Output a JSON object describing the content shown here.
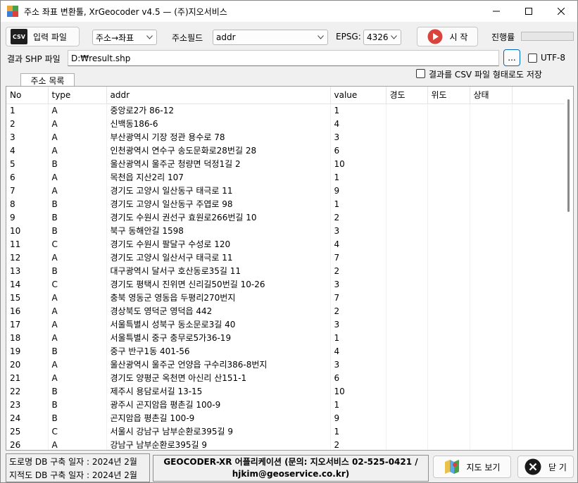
{
  "window": {
    "title": "주소 좌표 변환툴, XrGeocoder v4.5 — (주)지오서비스"
  },
  "toolbar": {
    "input_file_label": "입력 파일",
    "csv_icon_text": "CSV",
    "mode_value": "주소→좌표",
    "address_field_label": "주소필드",
    "address_field_value": "addr",
    "epsg_label": "EPSG:",
    "epsg_value": "4326",
    "start_label": "시 작",
    "progress_label": "진행률",
    "progress_fraction": 0
  },
  "output": {
    "label": "결과 SHP 파일",
    "path": "D:₩result.shp",
    "browse_label": "...",
    "utf8_label": "UTF-8",
    "utf8_checked": false,
    "csv_option_label": "결과를 CSV 파일 형태로도 저장",
    "csv_option_checked": false
  },
  "tab": {
    "label": "주소 목록"
  },
  "table": {
    "headers": [
      "No",
      "type",
      "addr",
      "value",
      "경도",
      "위도",
      "상태"
    ],
    "rows": [
      [
        "1",
        "A",
        "중앙로2가 86-12",
        "1"
      ],
      [
        "2",
        "A",
        "신백동186-6",
        "4"
      ],
      [
        "3",
        "A",
        "부산광역시 기장 정관 용수로 78",
        "3"
      ],
      [
        "4",
        "A",
        "인천광역시 연수구 송도문화로28번길 28",
        "6"
      ],
      [
        "5",
        "B",
        "울산광역시 울주군 청량면 덕정1길 2",
        "10"
      ],
      [
        "6",
        "A",
        "목천읍 지산2리 107",
        "1"
      ],
      [
        "7",
        "A",
        "경기도 고양시 일산동구 태극로 11",
        "9"
      ],
      [
        "8",
        "B",
        "경기도 고양시 일산동구 주엽로 98",
        "1"
      ],
      [
        "9",
        "B",
        "경기도 수원시 권선구 효원로266번길 10",
        "2"
      ],
      [
        "10",
        "B",
        "북구 동해안길 1598",
        "3"
      ],
      [
        "11",
        "C",
        "경기도 수원시 팔달구 수성로 120",
        "4"
      ],
      [
        "12",
        "A",
        "경기도 고양시 일산서구 태극로 11",
        "7"
      ],
      [
        "13",
        "B",
        "대구광역시 달서구 호산동로35길 11",
        "2"
      ],
      [
        "14",
        "C",
        "경기도 평택시 진위면 신리길50번길 10-26",
        "3"
      ],
      [
        "15",
        "A",
        "충북 영동군 영동읍 두평리270번지",
        "7"
      ],
      [
        "16",
        "A",
        "경상북도 영덕군 영덕읍 442",
        "2"
      ],
      [
        "17",
        "A",
        "서울특별시 성북구 동소문로3길 40",
        "3"
      ],
      [
        "18",
        "A",
        "서울특별시 중구 충무로5가36-19",
        "1"
      ],
      [
        "19",
        "B",
        "중구 반구1동 401-56",
        "4"
      ],
      [
        "20",
        "A",
        "울산광역시 울주군 언양읍 구수리386-8번지",
        "3"
      ],
      [
        "21",
        "A",
        "경기도 양평군 옥천면 아신리 산151-1",
        "6"
      ],
      [
        "22",
        "B",
        "제주시 용담로서길 13-15",
        "10"
      ],
      [
        "23",
        "B",
        "광주시 곤지암읍 평촌길 100-9",
        "1"
      ],
      [
        "24",
        "B",
        "곤지암읍 평촌길 100-9",
        "9"
      ],
      [
        "25",
        "C",
        "서울시 강남구 남부순환로395길 9",
        "1"
      ],
      [
        "26",
        "A",
        "강남구 남부순환로395길 9",
        "2"
      ]
    ]
  },
  "status": {
    "road_db": "도로명 DB 구축 일자 : 2024년 2월",
    "parcel_db": "지적도 DB 구축 일자 : 2024년 2월",
    "app_info_line1": "GEOCODER-XR 어플리케이션 (문의: 지오서비스 02-525-0421 /",
    "app_info_line2": "hjkim@geoservice.co.kr)",
    "map_button_label": "지도 보기",
    "close_button_label": "닫 기"
  },
  "colors": {
    "start_icon": "#d9433b",
    "close_icon": "#1a1a1a",
    "progress_fill": "#06b025",
    "browse_border": "#0067c0"
  }
}
